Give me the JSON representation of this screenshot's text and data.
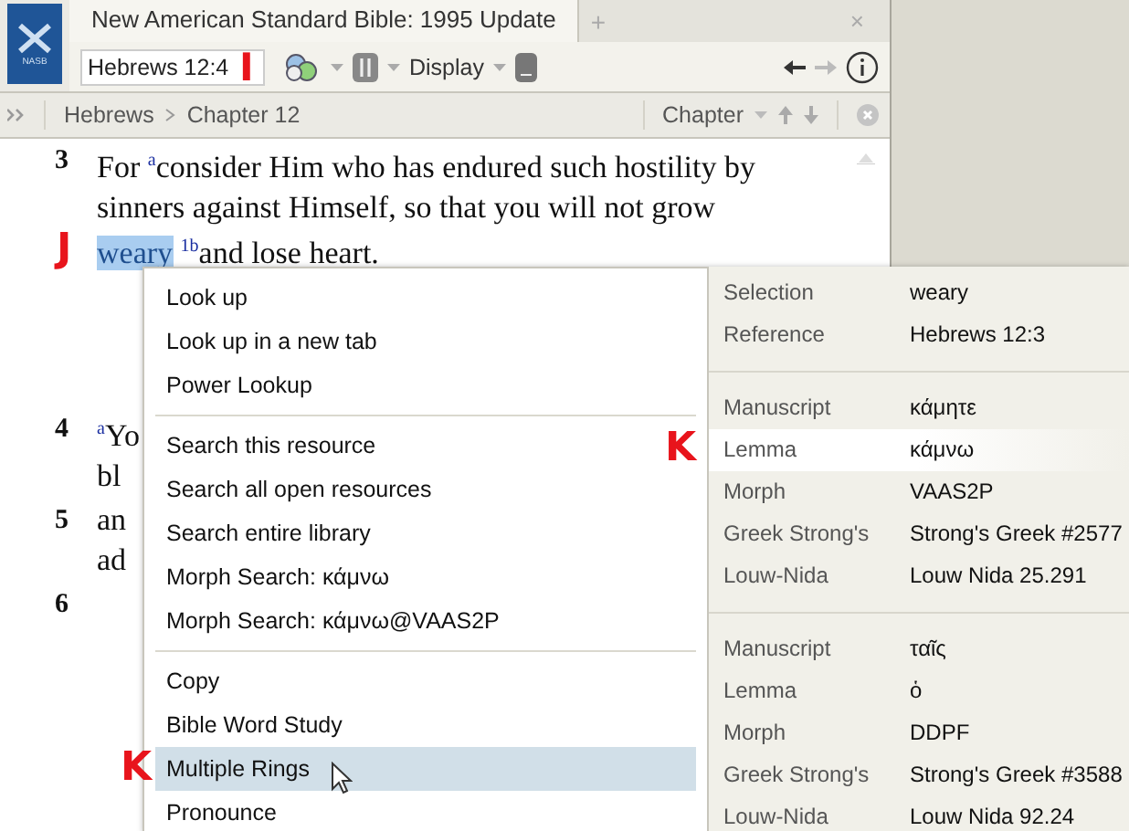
{
  "window": {
    "logo": "NASB",
    "tab_title": "New American Standard Bible: 1995 Update",
    "new_tab": "+",
    "close": "×"
  },
  "toolbar": {
    "reference": "Hebrews 12:4",
    "reference_callout": "I",
    "display": "Display"
  },
  "breadcrumb": {
    "items": [
      "Hebrews",
      "Chapter 12"
    ],
    "nav": "Chapter"
  },
  "verses": [
    {
      "number": "3",
      "lines": [
        {
          "text": "For $^{a}$consider Him who has endured such hostility by"
        },
        {
          "text": "sinners against Himself, so that you will not grow"
        },
        {
          "selected_word": "weary",
          "text": " $^{1b}$and lose heart.",
          "callout": "J"
        }
      ]
    },
    {
      "number": "4",
      "lines": [
        {
          "text": "$^{a}$Yo"
        },
        {
          "text": "bl"
        }
      ]
    },
    {
      "number": "5",
      "lines": [
        {
          "text": "an"
        },
        {
          "text": "ad"
        }
      ]
    },
    {
      "number": "6"
    }
  ],
  "context_menu": {
    "groups": [
      [
        {
          "label": "Look up",
          "selected": false
        },
        {
          "label": "Look up in a new tab",
          "selected": false
        },
        {
          "label": "Power Lookup",
          "selected": false
        }
      ],
      [
        {
          "label": "Search this resource",
          "selected": false
        },
        {
          "label": "Search all open resources",
          "selected": false
        },
        {
          "label": "Search entire library",
          "selected": false
        },
        {
          "label": "Morph Search: κάμνω",
          "selected": false
        },
        {
          "label": "Morph Search: κάμνω@VAAS2P",
          "selected": false
        }
      ],
      [
        {
          "label": "Copy",
          "selected": false
        },
        {
          "label": "Bible Word Study",
          "selected": false
        },
        {
          "label": "Multiple Rings",
          "selected": true,
          "callout": "K"
        },
        {
          "label": "Pronounce",
          "selected": false
        }
      ]
    ]
  },
  "info_panel": {
    "groups": [
      [
        {
          "label": "Selection",
          "value": "weary",
          "selected": false
        },
        {
          "label": "Reference",
          "value": "Hebrews 12:3",
          "selected": false
        }
      ],
      [
        {
          "label": "Manuscript",
          "value": "κάμητε",
          "selected": false
        },
        {
          "label": "Lemma",
          "value": "κάμνω",
          "selected": true,
          "callout": "K"
        },
        {
          "label": "Morph",
          "value": "VAAS2P",
          "selected": false
        },
        {
          "label": "Greek Strong's",
          "value": "Strong's Greek #2577",
          "selected": false
        },
        {
          "label": "Louw-Nida",
          "value": "Louw Nida 25.291",
          "selected": false
        }
      ],
      [
        {
          "label": "Manuscript",
          "value": "ταῖς",
          "selected": false
        },
        {
          "label": "Lemma",
          "value": "ὁ",
          "selected": false
        },
        {
          "label": "Morph",
          "value": "DDPF",
          "selected": false
        },
        {
          "label": "Greek Strong's",
          "value": "Strong's Greek #3588",
          "selected": false
        },
        {
          "label": "Louw-Nida",
          "value": "Louw Nida 92.24",
          "selected": false
        }
      ]
    ]
  }
}
